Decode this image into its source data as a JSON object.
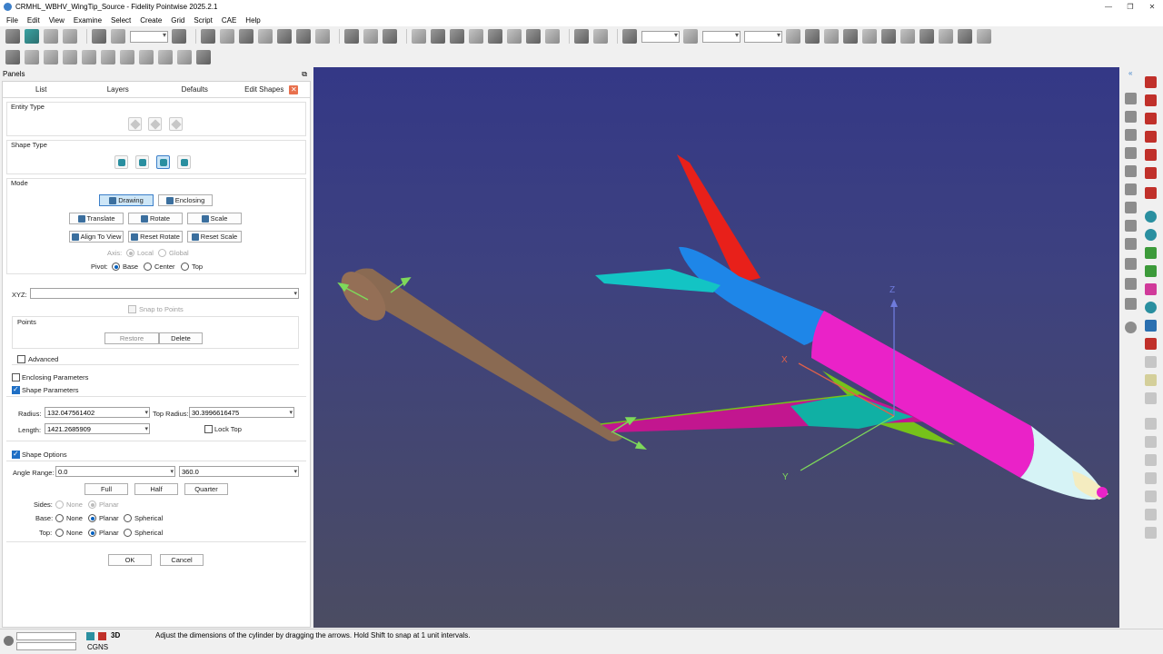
{
  "window": {
    "title": "CRMHL_WBHV_WingTip_Source - Fidelity Pointwise 2025.2.1"
  },
  "menu": [
    "File",
    "Edit",
    "View",
    "Examine",
    "Select",
    "Create",
    "Grid",
    "Script",
    "CAE",
    "Help"
  ],
  "panels": {
    "title": "Panels",
    "tabs": [
      "List",
      "Layers",
      "Defaults",
      "Edit Shapes"
    ],
    "active_tab": "Edit Shapes"
  },
  "edit_shapes": {
    "entity_type_label": "Entity Type",
    "shape_type_label": "Shape Type",
    "mode_label": "Mode",
    "drawing": "Drawing",
    "enclosing": "Enclosing",
    "translate": "Translate",
    "rotate": "Rotate",
    "scale": "Scale",
    "align_to_view": "Align To View",
    "reset_rotate": "Reset Rotate",
    "reset_scale": "Reset Scale",
    "axis_label": "Axis:",
    "axis_local": "Local",
    "axis_global": "Global",
    "pivot_label": "Pivot:",
    "pivot_base": "Base",
    "pivot_center": "Center",
    "pivot_top": "Top",
    "xyz_label": "XYZ:",
    "xyz_value": "",
    "snap_to_points": "Snap to Points",
    "points_label": "Points",
    "restore": "Restore",
    "delete": "Delete",
    "advanced": "Advanced",
    "enclosing_parameters": "Enclosing Parameters",
    "shape_parameters": "Shape Parameters",
    "radius_label": "Radius:",
    "radius_value": "132.047561402",
    "top_radius_label": "Top Radius:",
    "top_radius_value": "30.3996616475",
    "length_label": "Length:",
    "length_value": "1421.2685909",
    "lock_top": "Lock Top",
    "shape_options": "Shape Options",
    "angle_range_label": "Angle Range:",
    "angle_start": "0.0",
    "angle_end": "360.0",
    "full": "Full",
    "half": "Half",
    "quarter": "Quarter",
    "sides_label": "Sides:",
    "base_label": "Base:",
    "top_label": "Top:",
    "opt_none": "None",
    "opt_planar": "Planar",
    "opt_spherical": "Spherical",
    "ok": "OK",
    "cancel": "Cancel"
  },
  "viewport": {
    "axis_x": "X",
    "axis_y": "Y",
    "axis_z": "Z",
    "colors": {
      "tail": "#e8201a",
      "stabilizer": "#13c4c4",
      "fuselage_front": "#ea22c8",
      "fuselage_rear": "#1e86e8",
      "nose": "#d6f3f6",
      "wing_top": "#c2168f",
      "wing_green": "#76c21a",
      "cone": "#8a6a52",
      "arrow": "#7ed95a"
    }
  },
  "statusbar": {
    "message": "Adjust the dimensions of the cylinder by dragging the arrows. Hold Shift to snap at 1 unit intervals.",
    "solver": "CGNS",
    "dim": "3D"
  }
}
